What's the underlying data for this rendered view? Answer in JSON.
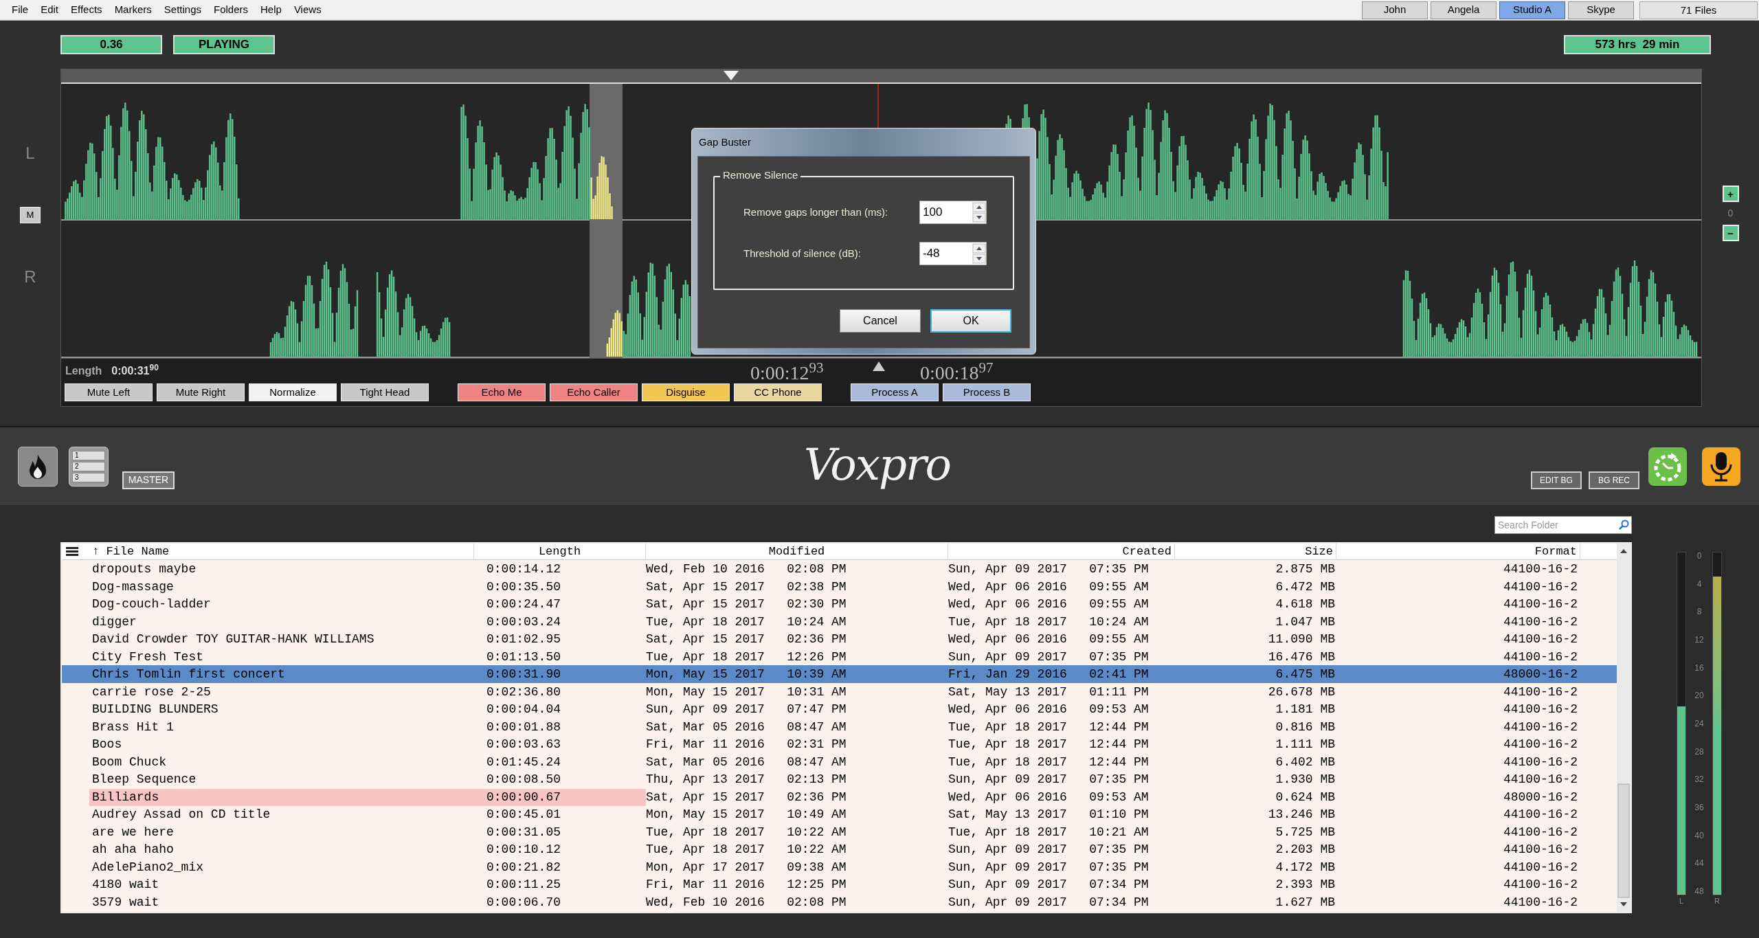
{
  "menu": [
    "File",
    "Edit",
    "Effects",
    "Markers",
    "Settings",
    "Folders",
    "Help",
    "Views"
  ],
  "user_tabs": [
    {
      "label": "John",
      "selected": false
    },
    {
      "label": "Angela",
      "selected": false
    },
    {
      "label": "Studio A",
      "selected": true
    },
    {
      "label": "Skype",
      "selected": false
    }
  ],
  "file_count": "71 Files",
  "status": {
    "level_reading": "0.36",
    "state": "PLAYING",
    "remaining": "573 hrs  29 min"
  },
  "channels": {
    "left": "L",
    "right": "R",
    "mute": "M"
  },
  "zoom": {
    "plus": "+",
    "value": "0",
    "minus": "−"
  },
  "length": {
    "label": "Length",
    "value": "0:00:31$^{90}$"
  },
  "times": {
    "start": "0:00:12$^{93}$",
    "end": "0:00:18$^{97}$"
  },
  "button_groups": [
    [
      {
        "label": "Mute Left",
        "color": "#c8c8c8"
      },
      {
        "label": "Mute Right",
        "color": "#c8c8c8"
      },
      {
        "label": "Normalize",
        "color": "#f2f2f2"
      },
      {
        "label": "Tight Head",
        "color": "#c8c8c8"
      }
    ],
    [
      {
        "label": "Echo Me",
        "color": "#f08484"
      },
      {
        "label": "Echo Caller",
        "color": "#f08484"
      },
      {
        "label": "Disguise",
        "color": "#f2c653"
      },
      {
        "label": "CC Phone",
        "color": "#ead7a0"
      }
    ],
    [
      {
        "label": "Process A",
        "color": "#a9badb"
      },
      {
        "label": "Process B",
        "color": "#a9badb"
      }
    ]
  ],
  "list_digits": [
    "1",
    "2",
    "3"
  ],
  "master": "MASTER",
  "logo": "Voxpro",
  "right_buttons": [
    "EDIT BG",
    "BG REC"
  ],
  "search": {
    "placeholder": "Search Folder"
  },
  "table": {
    "columns": [
      "↑ File Name",
      "Length",
      "Modified",
      "Created",
      "Size",
      "Format"
    ],
    "rows": [
      {
        "name": "dropouts maybe",
        "length": "0:00:14.12",
        "modified": "Wed, Feb 10 2016   02:08 PM",
        "created": "Sun, Apr 09 2017   07:35 PM",
        "size": "2.875 MB",
        "format": "44100-16-2",
        "selected": false,
        "flagged": false
      },
      {
        "name": "Dog-massage",
        "length": "0:00:35.50",
        "modified": "Sat, Apr 15 2017   02:38 PM",
        "created": "Wed, Apr 06 2016   09:55 AM",
        "size": "6.472 MB",
        "format": "44100-16-2",
        "selected": false,
        "flagged": false
      },
      {
        "name": "Dog-couch-ladder",
        "length": "0:00:24.47",
        "modified": "Sat, Apr 15 2017   02:30 PM",
        "created": "Wed, Apr 06 2016   09:55 AM",
        "size": "4.618 MB",
        "format": "44100-16-2",
        "selected": false,
        "flagged": false
      },
      {
        "name": "digger",
        "length": "0:00:03.24",
        "modified": "Tue, Apr 18 2017   10:24 AM",
        "created": "Tue, Apr 18 2017   10:24 AM",
        "size": "1.047 MB",
        "format": "44100-16-2",
        "selected": false,
        "flagged": false
      },
      {
        "name": "David Crowder TOY GUITAR-HANK WILLIAMS",
        "length": "0:01:02.95",
        "modified": "Sat, Apr 15 2017   02:36 PM",
        "created": "Wed, Apr 06 2016   09:55 AM",
        "size": "11.090 MB",
        "format": "44100-16-2",
        "selected": false,
        "flagged": false
      },
      {
        "name": "City Fresh Test",
        "length": "0:01:13.50",
        "modified": "Tue, Apr 18 2017   12:26 PM",
        "created": "Sun, Apr 09 2017   07:35 PM",
        "size": "16.476 MB",
        "format": "44100-16-2",
        "selected": false,
        "flagged": false
      },
      {
        "name": "Chris Tomlin first concert",
        "length": "0:00:31.90",
        "modified": "Mon, May 15 2017   10:39 AM",
        "created": "Fri, Jan 29 2016   02:41 PM",
        "size": "6.475 MB",
        "format": "48000-16-2",
        "selected": true,
        "flagged": false
      },
      {
        "name": "carrie rose 2-25",
        "length": "0:02:36.80",
        "modified": "Mon, May 15 2017   10:31 AM",
        "created": "Sat, May 13 2017   01:11 PM",
        "size": "26.678 MB",
        "format": "44100-16-2",
        "selected": false,
        "flagged": false
      },
      {
        "name": "BUILDING BLUNDERS",
        "length": "0:00:04.04",
        "modified": "Sun, Apr 09 2017   07:47 PM",
        "created": "Wed, Apr 06 2016   09:53 AM",
        "size": "1.181 MB",
        "format": "44100-16-2",
        "selected": false,
        "flagged": false
      },
      {
        "name": "Brass Hit 1",
        "length": "0:00:01.88",
        "modified": "Sat, Mar 05 2016   08:47 AM",
        "created": "Tue, Apr 18 2017   12:44 PM",
        "size": "0.816 MB",
        "format": "44100-16-2",
        "selected": false,
        "flagged": false
      },
      {
        "name": "Boos",
        "length": "0:00:03.63",
        "modified": "Fri, Mar 11 2016   02:31 PM",
        "created": "Tue, Apr 18 2017   12:44 PM",
        "size": "1.111 MB",
        "format": "44100-16-2",
        "selected": false,
        "flagged": false
      },
      {
        "name": "Boom Chuck",
        "length": "0:01:45.24",
        "modified": "Sat, Mar 05 2016   08:47 AM",
        "created": "Tue, Apr 18 2017   12:44 PM",
        "size": "6.402 MB",
        "format": "44100-16-2",
        "selected": false,
        "flagged": false
      },
      {
        "name": "Bleep Sequence",
        "length": "0:00:08.50",
        "modified": "Thu, Apr 13 2017   02:13 PM",
        "created": "Sun, Apr 09 2017   07:35 PM",
        "size": "1.930 MB",
        "format": "44100-16-2",
        "selected": false,
        "flagged": false
      },
      {
        "name": "Billiards",
        "length": "0:00:00.67",
        "modified": "Sat, Apr 15 2017   02:36 PM",
        "created": "Wed, Apr 06 2016   09:53 AM",
        "size": "0.624 MB",
        "format": "48000-16-2",
        "selected": false,
        "flagged": true
      },
      {
        "name": "Audrey Assad on CD title",
        "length": "0:00:45.01",
        "modified": "Mon, May 15 2017   10:49 AM",
        "created": "Sat, May 13 2017   01:10 PM",
        "size": "13.246 MB",
        "format": "44100-16-2",
        "selected": false,
        "flagged": false
      },
      {
        "name": "are we here",
        "length": "0:00:31.05",
        "modified": "Tue, Apr 18 2017   10:22 AM",
        "created": "Tue, Apr 18 2017   10:21 AM",
        "size": "5.725 MB",
        "format": "44100-16-2",
        "selected": false,
        "flagged": false
      },
      {
        "name": "ah aha haho",
        "length": "0:00:10.12",
        "modified": "Tue, Apr 18 2017   10:22 AM",
        "created": "Sun, Apr 09 2017   07:35 PM",
        "size": "2.203 MB",
        "format": "44100-16-2",
        "selected": false,
        "flagged": false
      },
      {
        "name": "AdelePiano2_mix",
        "length": "0:00:21.82",
        "modified": "Mon, Apr 17 2017   09:38 AM",
        "created": "Sun, Apr 09 2017   07:35 PM",
        "size": "4.172 MB",
        "format": "44100-16-2",
        "selected": false,
        "flagged": false
      },
      {
        "name": "4180 wait",
        "length": "0:00:11.25",
        "modified": "Fri, Mar 11 2016   12:25 PM",
        "created": "Sun, Apr 09 2017   07:34 PM",
        "size": "2.393 MB",
        "format": "44100-16-2",
        "selected": false,
        "flagged": false
      },
      {
        "name": "3579 wait",
        "length": "0:00:06.70",
        "modified": "Wed, Feb 10 2016   02:08 PM",
        "created": "Sun, Apr 09 2017   07:34 PM",
        "size": "1.627 MB",
        "format": "44100-16-2",
        "selected": false,
        "flagged": false
      }
    ]
  },
  "meters": {
    "scale": [
      "0",
      "4",
      "8",
      "12",
      "16",
      "20",
      "24",
      "28",
      "32",
      "36",
      "40",
      "44",
      "48"
    ],
    "channels": [
      {
        "name": "L",
        "level": 0.55
      },
      {
        "name": "R",
        "level": 0.93
      }
    ]
  },
  "dialog": {
    "title": "Gap Buster",
    "group": "Remove Silence",
    "fields": [
      {
        "label": "Remove gaps longer than (ms):",
        "value": "100"
      },
      {
        "label": "Threshold of silence (dB):",
        "value": "-48"
      }
    ],
    "buttons": [
      {
        "label": "Cancel",
        "default": false
      },
      {
        "label": "OK",
        "default": true
      }
    ]
  }
}
